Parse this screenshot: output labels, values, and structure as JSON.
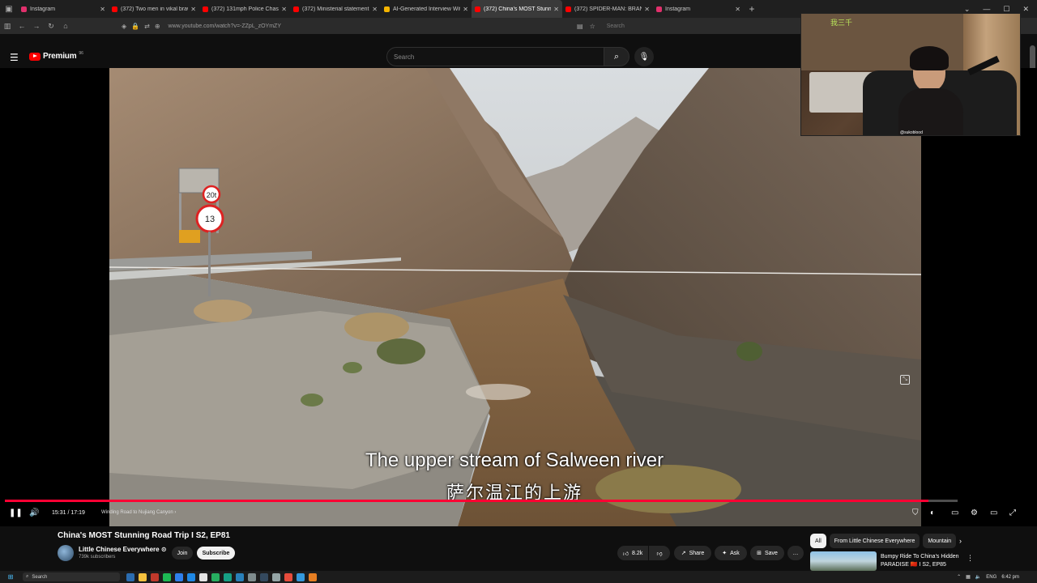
{
  "browser": {
    "tabs": [
      {
        "title": "Instagram",
        "color": "#e1306c",
        "active": false
      },
      {
        "title": "(372) Two men in vikal brawl at",
        "color": "#ff0000",
        "active": false
      },
      {
        "title": "(372) 131mph Police Chase End",
        "color": "#ff0000",
        "active": false
      },
      {
        "title": "(372) Ministerial statement by C",
        "color": "#ff0000",
        "active": false
      },
      {
        "title": "AI-Generated Interview With C",
        "color": "#f4b400",
        "active": false
      },
      {
        "title": "(372) China's MOST Stunnin",
        "color": "#ff0000",
        "active": true
      },
      {
        "title": "(372) SPIDER-MAN: BRAND NE",
        "color": "#ff0000",
        "active": false
      },
      {
        "title": "Instagram",
        "color": "#e1306c",
        "active": false
      }
    ],
    "new_tab": "+",
    "url": "www.youtube.com/watch?v=-ZZpL_zOYmZY",
    "search_placeholder": "Search"
  },
  "masthead": {
    "logo_text": "Premium",
    "logo_sup": "96",
    "search_placeholder": "Search"
  },
  "video": {
    "subtitle_en": "The upper stream of Salween river",
    "subtitle_zh": "萨尔温江的上游",
    "progress_fraction": 0.9692,
    "time_current": "15:31",
    "time_total": "17:19",
    "time_display": "15:31 / 17:19",
    "chapter": "Winding Road to Nujiang Canyon",
    "road_sign_top": "20t",
    "road_sign_bottom": "13",
    "accent_color": "#ff0033"
  },
  "webcam": {
    "handle": "@sukoblood",
    "sign_text": "我三千"
  },
  "info": {
    "title": "China's MOST Stunning Road Trip I S2, EP81",
    "channel_name": "Little Chinese Everywhere",
    "verified": "⊙",
    "subscribers": "739k subscribers",
    "join_label": "Join",
    "subscribe_label": "Subscribe",
    "like_count": "8.2k",
    "share_label": "Share",
    "ask_label": "Ask",
    "save_label": "Save",
    "more_label": "…"
  },
  "sidebar": {
    "chips": [
      "All",
      "From Little Chinese Everywhere",
      "Mountain"
    ],
    "rec_title": "Bumpy Ride To China's Hidden PARADISE 🇨🇳 I S2, EP85"
  },
  "taskbar": {
    "search_placeholder": "Search",
    "lang": "ENG",
    "clock": "6:42 pm"
  }
}
